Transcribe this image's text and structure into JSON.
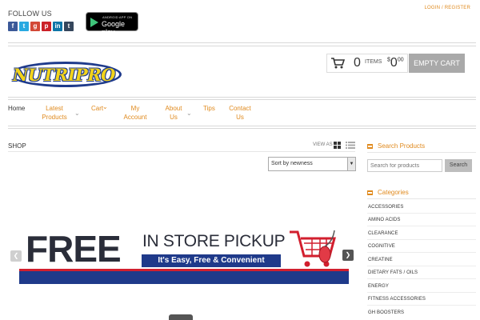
{
  "header": {
    "follow_label": "FOLLOW US",
    "social_icons": [
      "facebook-icon",
      "twitter-icon",
      "google-plus-icon",
      "pinterest-icon",
      "linkedin-icon",
      "tumblr-icon"
    ],
    "app_badge_small": "ANDROID APP ON",
    "app_badge_big": "Google play",
    "login_link": "LOGIN / REGISTER"
  },
  "brand": {
    "logo_text": "NUTRIPRO"
  },
  "cart": {
    "count": "0",
    "items_label": "ITEMS",
    "currency": "$",
    "total": "0",
    "total_cents": "00",
    "empty_label": "EMPTY CART"
  },
  "nav": {
    "home": "Home",
    "latest_1": "Latest",
    "latest_2": "Products",
    "cart": "Cart",
    "account_1": "My",
    "account_2": "Account",
    "about_1": "About",
    "about_2": "Us",
    "tips": "Tips",
    "contact_1": "Contact",
    "contact_2": "Us"
  },
  "shop": {
    "title": "SHOP",
    "view_as": "VIEW AS",
    "sort_value": "Sort by newness"
  },
  "banner": {
    "free": "FREE",
    "in_store": "IN STORE PICKUP",
    "sub": "It's Easy, Free & Convenient"
  },
  "sidebar": {
    "search_heading": "Search Products",
    "search_placeholder": "Search for products",
    "search_button": "Search",
    "categories_heading": "Categories",
    "categories": [
      "ACCESSORIES",
      "AMINO ACIDS",
      "CLEARANCE",
      "COGNITIVE",
      "CREATINE",
      "DIETARY FATS / OILS",
      "ENERGY",
      "FITNESS ACCESSORIES",
      "GH BOOSTERS"
    ]
  },
  "colors": {
    "accent": "#e08a1e",
    "brand_blue": "#1f3a8a",
    "brand_red": "#d21f2e",
    "button_gray": "#a9a9a9"
  }
}
